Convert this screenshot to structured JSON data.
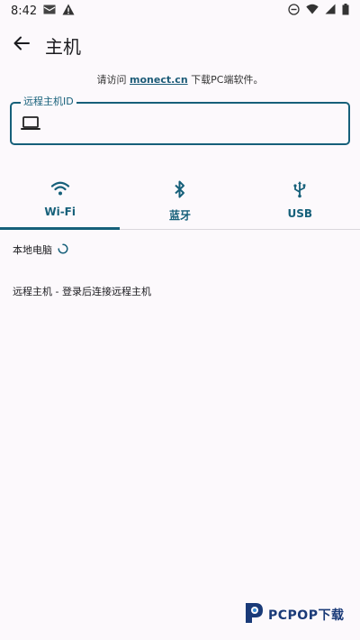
{
  "status_bar": {
    "time": "8:42",
    "left_icons": [
      "mail-icon",
      "alert-icon"
    ],
    "right_icons": [
      "do-not-disturb-icon",
      "wifi-icon",
      "signal-icon",
      "battery-icon"
    ]
  },
  "appbar": {
    "title": "主机"
  },
  "hint": {
    "prefix": "请访问 ",
    "link": "monect.cn",
    "suffix": " 下载PC端软件。"
  },
  "field": {
    "label": "远程主机ID",
    "value": "",
    "placeholder": ""
  },
  "tabs": [
    {
      "label": "Wi-Fi",
      "icon": "wifi-icon",
      "selected": true
    },
    {
      "label": "蓝牙",
      "icon": "bluetooth-icon",
      "selected": false
    },
    {
      "label": "USB",
      "icon": "usb-icon",
      "selected": false
    }
  ],
  "local": {
    "label": "本地电脑"
  },
  "remote": {
    "label": "远程主机 - 登录后连接远程主机"
  },
  "watermark": {
    "brand": "PCPOP下载"
  },
  "colors": {
    "accent": "#16607a",
    "background": "#fcf9fc"
  }
}
